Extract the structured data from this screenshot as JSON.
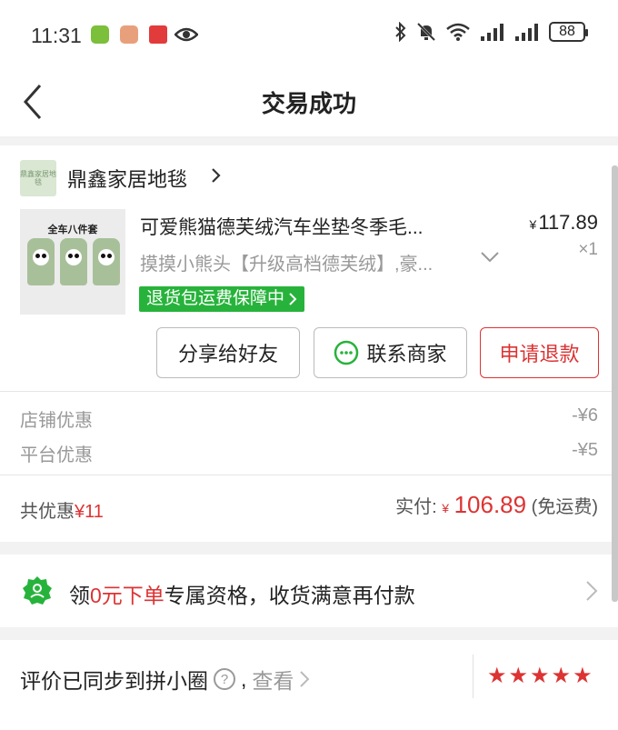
{
  "status_bar": {
    "time": "11:31",
    "battery": "88"
  },
  "header": {
    "title": "交易成功"
  },
  "order": {
    "shop_name": "鼎鑫家居地毯",
    "shop_logo_text": "鼎鑫家居地毯",
    "product": {
      "thumb_label": "全车八件套",
      "title": "可爱熊猫德芙绒汽车坐垫冬季毛...",
      "price_symbol": "¥",
      "price": "117.89",
      "variant": "摸摸小熊头【升级高档德芙绒】,豪...",
      "quantity": "×1",
      "badge": "退货包运费保障中"
    },
    "buttons": {
      "share": "分享给好友",
      "contact": "联系商家",
      "refund": "申请退款"
    },
    "discounts": [
      {
        "label": "店铺优惠",
        "value": "-¥6"
      },
      {
        "label": "平台优惠",
        "value": "-¥5"
      }
    ],
    "total": {
      "discount_label": "共优惠",
      "discount_value": "¥11",
      "paid_label": "实付: ",
      "paid_symbol": "¥",
      "paid_value": "106.89",
      "shipping_note": "(免运费)"
    }
  },
  "promo": {
    "prefix": "领",
    "highlight": "0元下单",
    "suffix": "专属资格，收货满意再付款"
  },
  "review": {
    "text": "评价已同步到拼小圈",
    "sep": ",",
    "link": "查看",
    "rating": 5
  },
  "colors": {
    "accent_red": "#dd3333",
    "badge_green": "#27b33b"
  }
}
